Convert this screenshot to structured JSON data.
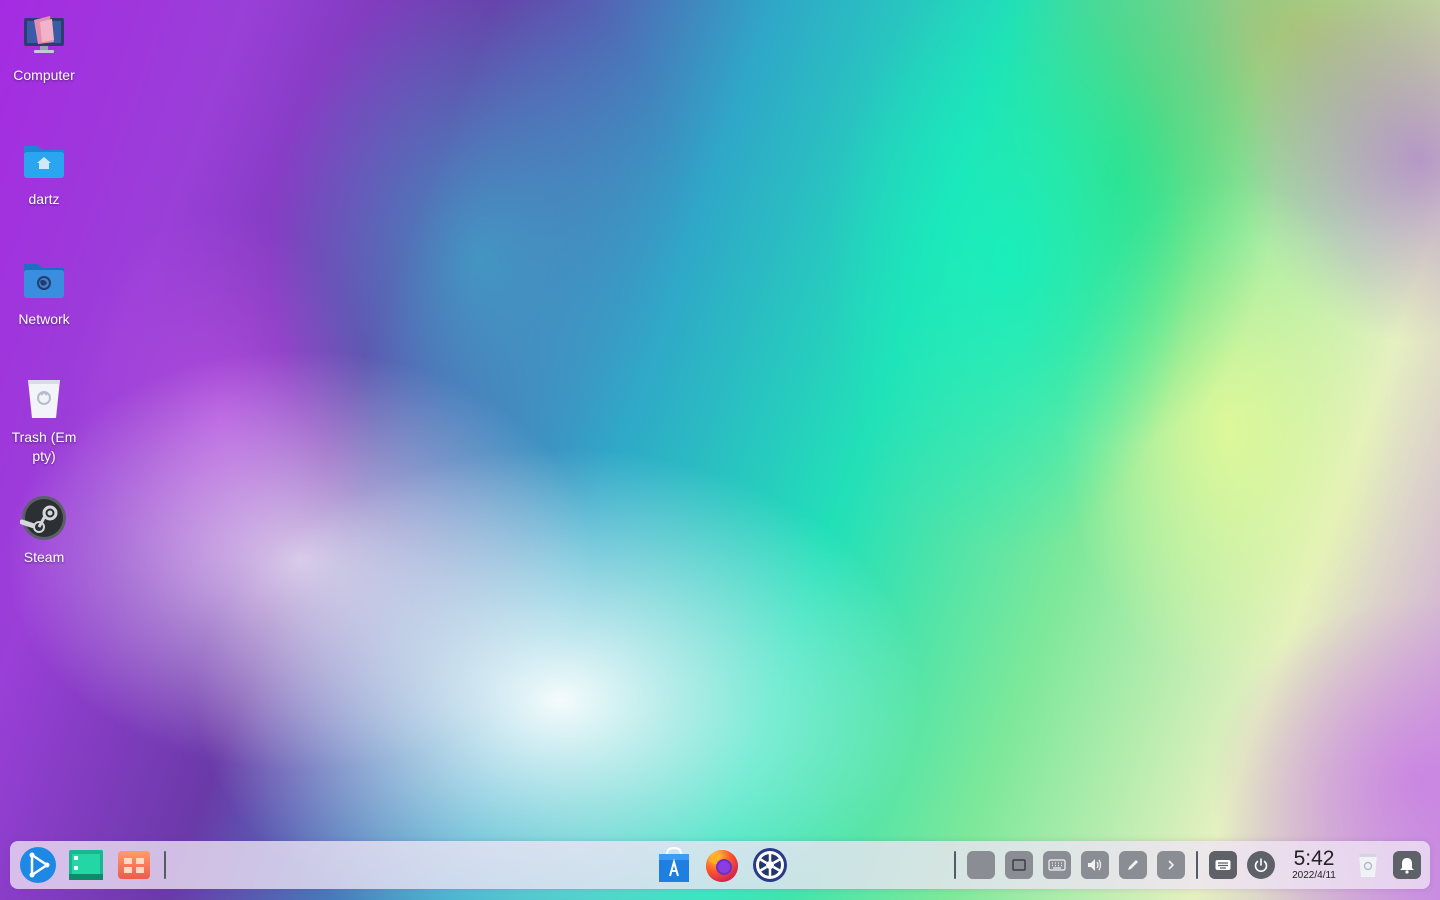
{
  "desktop": {
    "items": [
      {
        "label": "Computer",
        "icon": "computer-icon"
      },
      {
        "label": "dartz",
        "icon": "home-folder-icon"
      },
      {
        "label": "Network",
        "icon": "network-folder-icon"
      },
      {
        "label": "Trash (Empty)",
        "icon": "trash-icon"
      },
      {
        "label": "Steam",
        "icon": "steam-icon"
      }
    ]
  },
  "dock": {
    "left_apps": [
      {
        "name": "launcher",
        "icon": "launcher-icon"
      },
      {
        "name": "multitasking",
        "icon": "multitasking-view-icon"
      },
      {
        "name": "show-desktop",
        "icon": "show-desktop-icon"
      }
    ],
    "center_apps": [
      {
        "name": "app-store",
        "icon": "app-store-icon"
      },
      {
        "name": "firefox",
        "icon": "firefox-icon"
      },
      {
        "name": "settings",
        "icon": "control-center-icon"
      }
    ],
    "tray": [
      {
        "name": "tray-app",
        "icon": "tray-app-icon"
      },
      {
        "name": "screen",
        "icon": "screen-icon"
      },
      {
        "name": "keyboard",
        "icon": "keyboard-icon"
      },
      {
        "name": "volume",
        "icon": "volume-icon"
      },
      {
        "name": "pen",
        "icon": "pen-icon"
      },
      {
        "name": "expand",
        "icon": "chevron-right-icon"
      }
    ],
    "onscreen_keyboard_icon": "onscreen-keyboard-icon",
    "power_icon": "power-icon",
    "clock": {
      "time": "5:42",
      "date": "2022/4/11"
    },
    "trash_icon": "trash-icon",
    "notifications_icon": "bell-icon"
  },
  "colors": {
    "dock_bg": "#eee4f5",
    "tray_button": "#8a8d94",
    "launcher_blue": "#1e88e5"
  }
}
